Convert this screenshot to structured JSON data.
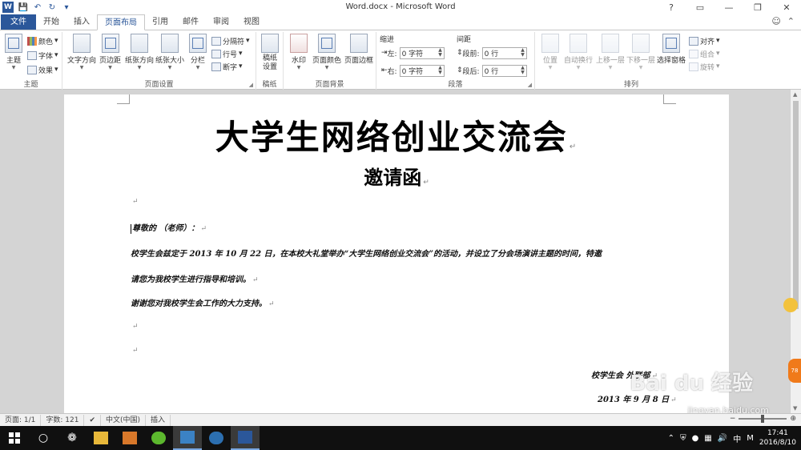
{
  "window": {
    "title": "Word.docx - Microsoft Word",
    "app_logo": "W"
  },
  "tabs": [
    {
      "label": "文件"
    },
    {
      "label": "开始"
    },
    {
      "label": "插入"
    },
    {
      "label": "页面布局"
    },
    {
      "label": "引用"
    },
    {
      "label": "邮件"
    },
    {
      "label": "审阅"
    },
    {
      "label": "视图"
    }
  ],
  "ribbon": {
    "theme": {
      "label": "主题",
      "big": "主题",
      "colors": "颜色",
      "fonts": "字体",
      "effects": "效果"
    },
    "page_setup": {
      "label": "页面设置",
      "text_direction": "文字方向",
      "margins": "页边距",
      "orientation": "纸张方向",
      "size": "纸张大小",
      "columns": "分栏",
      "breaks": "分隔符",
      "line_numbers": "行号",
      "hyphenation": "断字"
    },
    "draft": {
      "label": "稿纸",
      "button": "稿纸\n设置"
    },
    "page_background": {
      "label": "页面背景",
      "watermark": "水印",
      "page_color": "页面颜色",
      "page_borders": "页面边框"
    },
    "paragraph": {
      "label": "段落",
      "indent_title": "缩进",
      "spacing_title": "间距",
      "left_label": "左:",
      "left_value": "0 字符",
      "right_label": "右:",
      "right_value": "0 字符",
      "before_label": "段前:",
      "before_value": "0 行",
      "after_label": "段后:",
      "after_value": "0 行"
    },
    "arrange": {
      "label": "排列",
      "position": "位置",
      "wrap": "自动换行",
      "forward": "上移一层",
      "backward": "下移一层",
      "selection_pane": "选择窗格",
      "align": "对齐",
      "group": "组合",
      "rotate": "旋转"
    }
  },
  "document": {
    "title": "大学生网络创业交流会",
    "subtitle": "邀请函",
    "salutation": "尊敬的         （老师）：",
    "body_line1": "校学生会兹定于 2013 年 10 月 22 日，在本校大礼堂举办“大学生网络创业交流会”的活动，并设立了分会场演讲主题的时间，特邀",
    "body_line2": "请您为我校学生进行指导和培训。",
    "body_line3": "谢谢您对我校学生会工作的大力支持。",
    "signature": "校学生会 外联部",
    "date": "2013 年 9 月 8 日"
  },
  "statusbar": {
    "page": "页面: 1/1",
    "words": "字数: 121",
    "language": "中文(中国)",
    "mode": "插入"
  },
  "taskbar": {
    "time": "17:41",
    "date": "2016/8/10",
    "ime": "中",
    "ime2": "M"
  },
  "watermark": {
    "text": "Bai du 经验",
    "url": "jingyan.baidu.com"
  },
  "colors": {
    "word_blue": "#2b579a",
    "taskbar": "#101010"
  }
}
